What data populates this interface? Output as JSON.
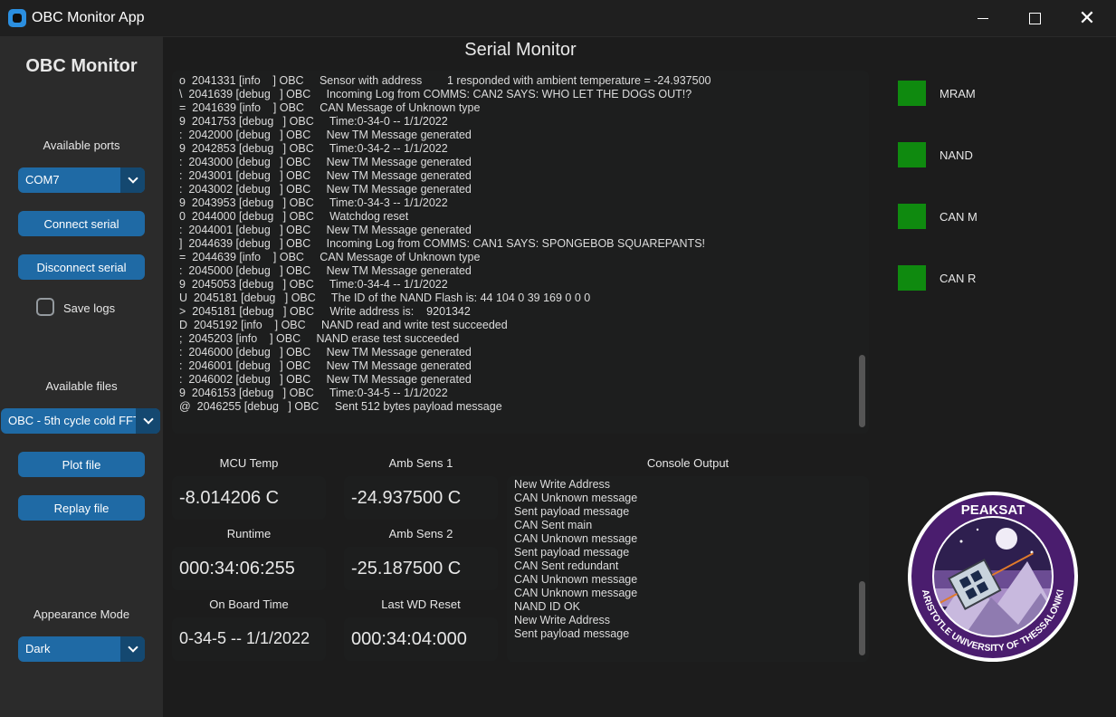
{
  "window": {
    "title": "OBC Monitor App",
    "close_glyph": "✕"
  },
  "sidebar": {
    "title": "OBC Monitor",
    "ports_label": "Available ports",
    "port_value": "COM7",
    "connect_label": "Connect serial",
    "disconnect_label": "Disconnect serial",
    "save_logs_label": "Save logs",
    "files_label": "Available files",
    "file_value": "OBC - 5th cycle cold FFT",
    "plot_label": "Plot file",
    "replay_label": "Replay file",
    "appearance_label": "Appearance Mode",
    "appearance_value": "Dark"
  },
  "serial_monitor": {
    "title": "Serial Monitor",
    "lines": [
      "o  2041331 [info    ] OBC     Sensor with address        1 responded with ambient temperature = -24.937500",
      "\\  2041639 [debug   ] OBC     Incoming Log from COMMS: CAN2 SAYS: WHO LET THE DOGS OUT!?",
      "=  2041639 [info    ] OBC     CAN Message of Unknown type",
      "9  2041753 [debug   ] OBC     Time:0-34-0 -- 1/1/2022",
      ":  2042000 [debug   ] OBC     New TM Message generated",
      "9  2042853 [debug   ] OBC     Time:0-34-2 -- 1/1/2022",
      ":  2043000 [debug   ] OBC     New TM Message generated",
      ":  2043001 [debug   ] OBC     New TM Message generated",
      ":  2043002 [debug   ] OBC     New TM Message generated",
      "9  2043953 [debug   ] OBC     Time:0-34-3 -- 1/1/2022",
      "0  2044000 [debug   ] OBC     Watchdog reset",
      ":  2044001 [debug   ] OBC     New TM Message generated",
      "]  2044639 [debug   ] OBC     Incoming Log from COMMS: CAN1 SAYS: SPONGEBOB SQUAREPANTS!",
      "=  2044639 [info    ] OBC     CAN Message of Unknown type",
      ":  2045000 [debug   ] OBC     New TM Message generated",
      "9  2045053 [debug   ] OBC     Time:0-34-4 -- 1/1/2022",
      "U  2045181 [debug   ] OBC     The ID of the NAND Flash is: 44 104 0 39 169 0 0 0",
      ">  2045181 [debug   ] OBC     Write address is:    9201342",
      "D  2045192 [info    ] OBC     NAND read and write test succeeded",
      ";  2045203 [info    ] OBC     NAND erase test succeeded",
      ":  2046000 [debug   ] OBC     New TM Message generated",
      ":  2046001 [debug   ] OBC     New TM Message generated",
      ":  2046002 [debug   ] OBC     New TM Message generated",
      "9  2046153 [debug   ] OBC     Time:0-34-5 -- 1/1/2022",
      "@  2046255 [debug   ] OBC     Sent 512 bytes payload message"
    ]
  },
  "stats": {
    "mcu_temp_label": "MCU Temp",
    "mcu_temp": "-8.014206 C",
    "amb1_label": "Amb Sens 1",
    "amb1": "-24.937500 C",
    "runtime_label": "Runtime",
    "runtime": "000:34:06:255",
    "amb2_label": "Amb Sens 2",
    "amb2": "-25.187500 C",
    "obt_label": "On Board Time",
    "obt": "0-34-5 -- 1/1/2022",
    "wd_label": "Last WD Reset",
    "wd": "000:34:04:000"
  },
  "console": {
    "label": "Console Output",
    "lines": [
      "New Write Address",
      "CAN Unknown message",
      "Sent payload message",
      "CAN Sent main",
      "CAN Unknown message",
      "Sent payload message",
      "CAN Sent redundant",
      "CAN Unknown message",
      "CAN Unknown message",
      "NAND ID OK",
      "New Write Address",
      "Sent payload message"
    ]
  },
  "indicators": {
    "color": "#0f8a0f",
    "mram": "MRAM",
    "nand": "NAND",
    "can_m": "CAN M",
    "can_r": "CAN R"
  },
  "logo": {
    "top_text": "PEAKSAT",
    "ring_text": "ARISTOTLE UNIVERSITY OF THESSALONIKI"
  },
  "colors": {
    "accent": "#1f6aa5",
    "accent_dark": "#144870",
    "sidebar": "#2b2b2b",
    "background": "#1c1c1c"
  }
}
